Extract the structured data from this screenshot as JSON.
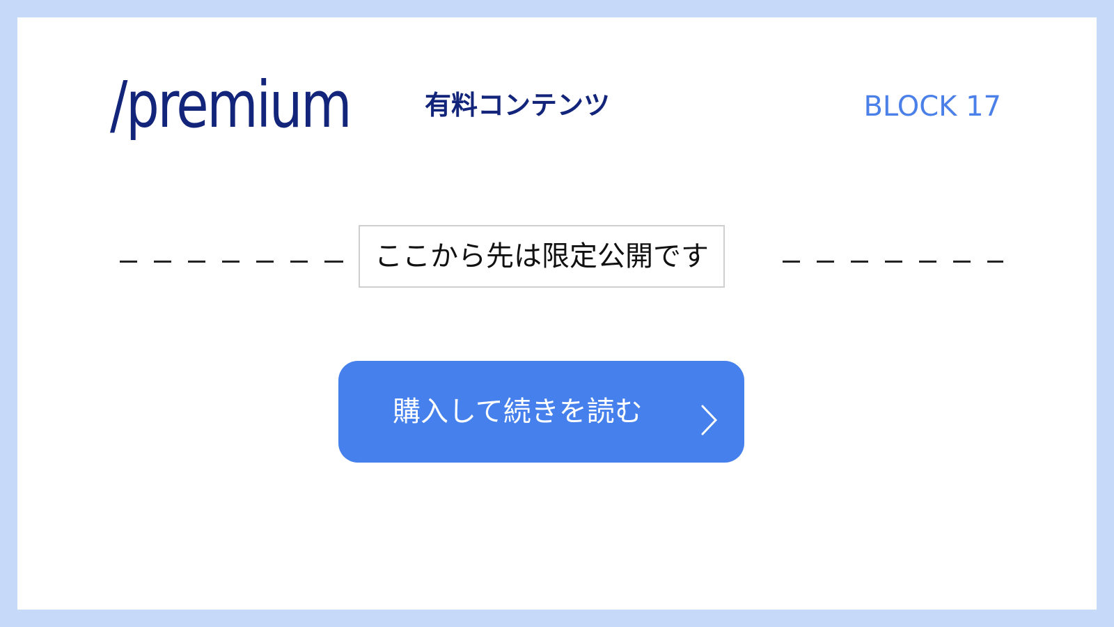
{
  "header": {
    "slug": "/premium",
    "subtitle": "有料コンテンツ",
    "block_label": "BLOCK 17"
  },
  "paywall": {
    "notice": "ここから先は限定公開です",
    "divider_style": "dashed"
  },
  "cta": {
    "label": "購入して続きを読む",
    "icon": "chevron-right-icon"
  },
  "colors": {
    "frame": "#c6d9f8",
    "panel": "#ffffff",
    "title": "#13257a",
    "accent": "#4a80e8",
    "button": "#4580ec",
    "button_text": "#ffffff",
    "notice_border": "#cfcfcf",
    "notice_text": "#111111"
  }
}
